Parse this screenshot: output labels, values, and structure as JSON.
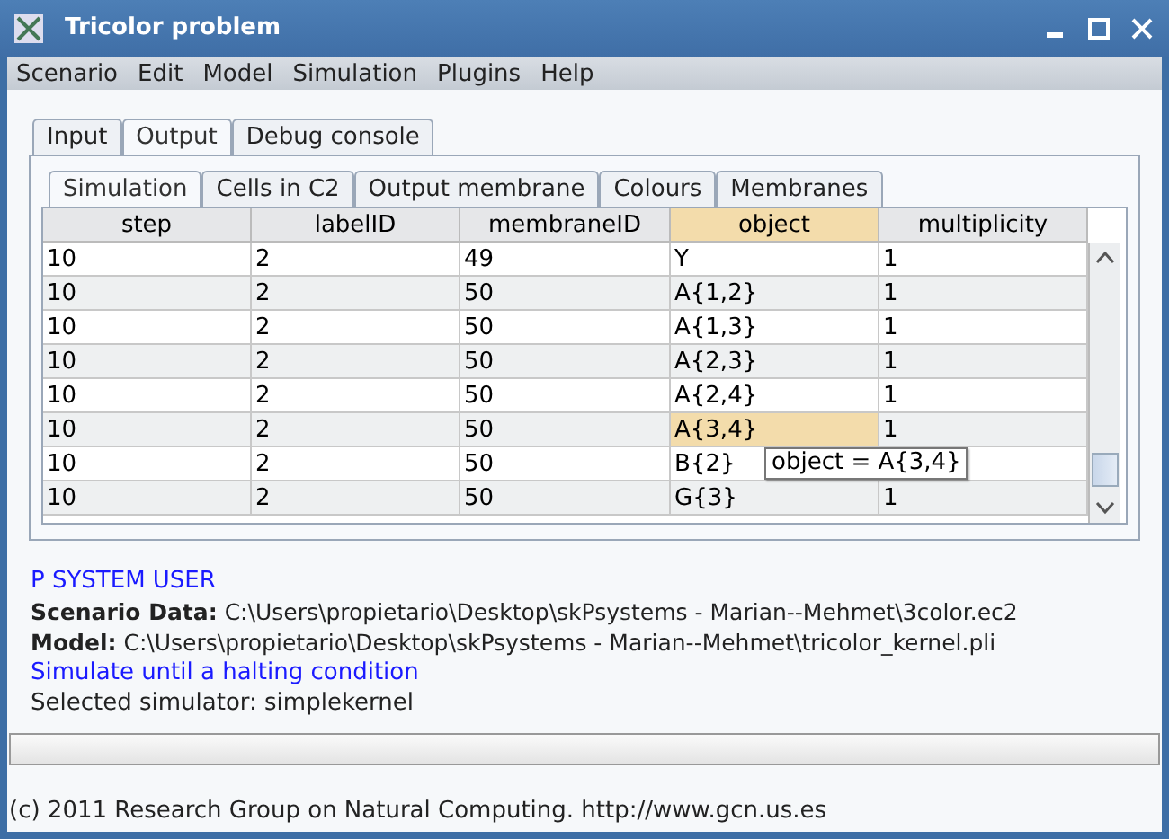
{
  "window": {
    "title": "Tricolor problem"
  },
  "menu": [
    "Scenario",
    "Edit",
    "Model",
    "Simulation",
    "Plugins",
    "Help"
  ],
  "tabs": [
    {
      "label": "Input",
      "selected": false
    },
    {
      "label": "Output",
      "selected": true
    },
    {
      "label": "Debug console",
      "selected": false
    }
  ],
  "subtabs": [
    {
      "label": "Simulation",
      "selected": true
    },
    {
      "label": "Cells in C2",
      "selected": false
    },
    {
      "label": "Output membrane",
      "selected": false
    },
    {
      "label": "Colours",
      "selected": false
    },
    {
      "label": "Membranes",
      "selected": false
    }
  ],
  "table": {
    "columns": [
      {
        "label": "step",
        "selected": false
      },
      {
        "label": "labelID",
        "selected": false
      },
      {
        "label": "membraneID",
        "selected": false
      },
      {
        "label": "object",
        "selected": true
      },
      {
        "label": "multiplicity",
        "selected": false
      }
    ],
    "rows": [
      {
        "cells": [
          "10",
          "2",
          "49",
          "Y",
          "1"
        ],
        "selected": false
      },
      {
        "cells": [
          "10",
          "2",
          "50",
          "A{1,2}",
          "1"
        ],
        "selected": false
      },
      {
        "cells": [
          "10",
          "2",
          "50",
          "A{1,3}",
          "1"
        ],
        "selected": false
      },
      {
        "cells": [
          "10",
          "2",
          "50",
          "A{2,3}",
          "1"
        ],
        "selected": false
      },
      {
        "cells": [
          "10",
          "2",
          "50",
          "A{2,4}",
          "1"
        ],
        "selected": false
      },
      {
        "cells": [
          "10",
          "2",
          "50",
          "A{3,4}",
          "1"
        ],
        "selected": true
      },
      {
        "cells": [
          "10",
          "2",
          "50",
          "B{2}",
          ""
        ],
        "selected": false
      },
      {
        "cells": [
          "10",
          "2",
          "50",
          "G{3}",
          "1"
        ],
        "selected": false
      }
    ],
    "tooltip": "object = A{3,4}"
  },
  "console": [
    {
      "kind": "note",
      "text": "P SYSTEM USER"
    },
    {
      "kind": "field",
      "label": "Scenario Data:",
      "value": "C:\\Users\\propietario\\Desktop\\skPsystems - Marian--Mehmet\\3color.ec2"
    },
    {
      "kind": "field",
      "label": "Model:",
      "value": "C:\\Users\\propietario\\Desktop\\skPsystems - Marian--Mehmet\\tricolor_kernel.pli"
    },
    {
      "kind": "note",
      "text": "Simulate until a halting condition"
    },
    {
      "kind": "plain",
      "text": "Selected simulator: simplekernel"
    }
  ],
  "progress": {
    "level": 0
  },
  "status_bar": "(c) 2011 Research Group on Natural Computing. http://www.gcn.us.es"
}
